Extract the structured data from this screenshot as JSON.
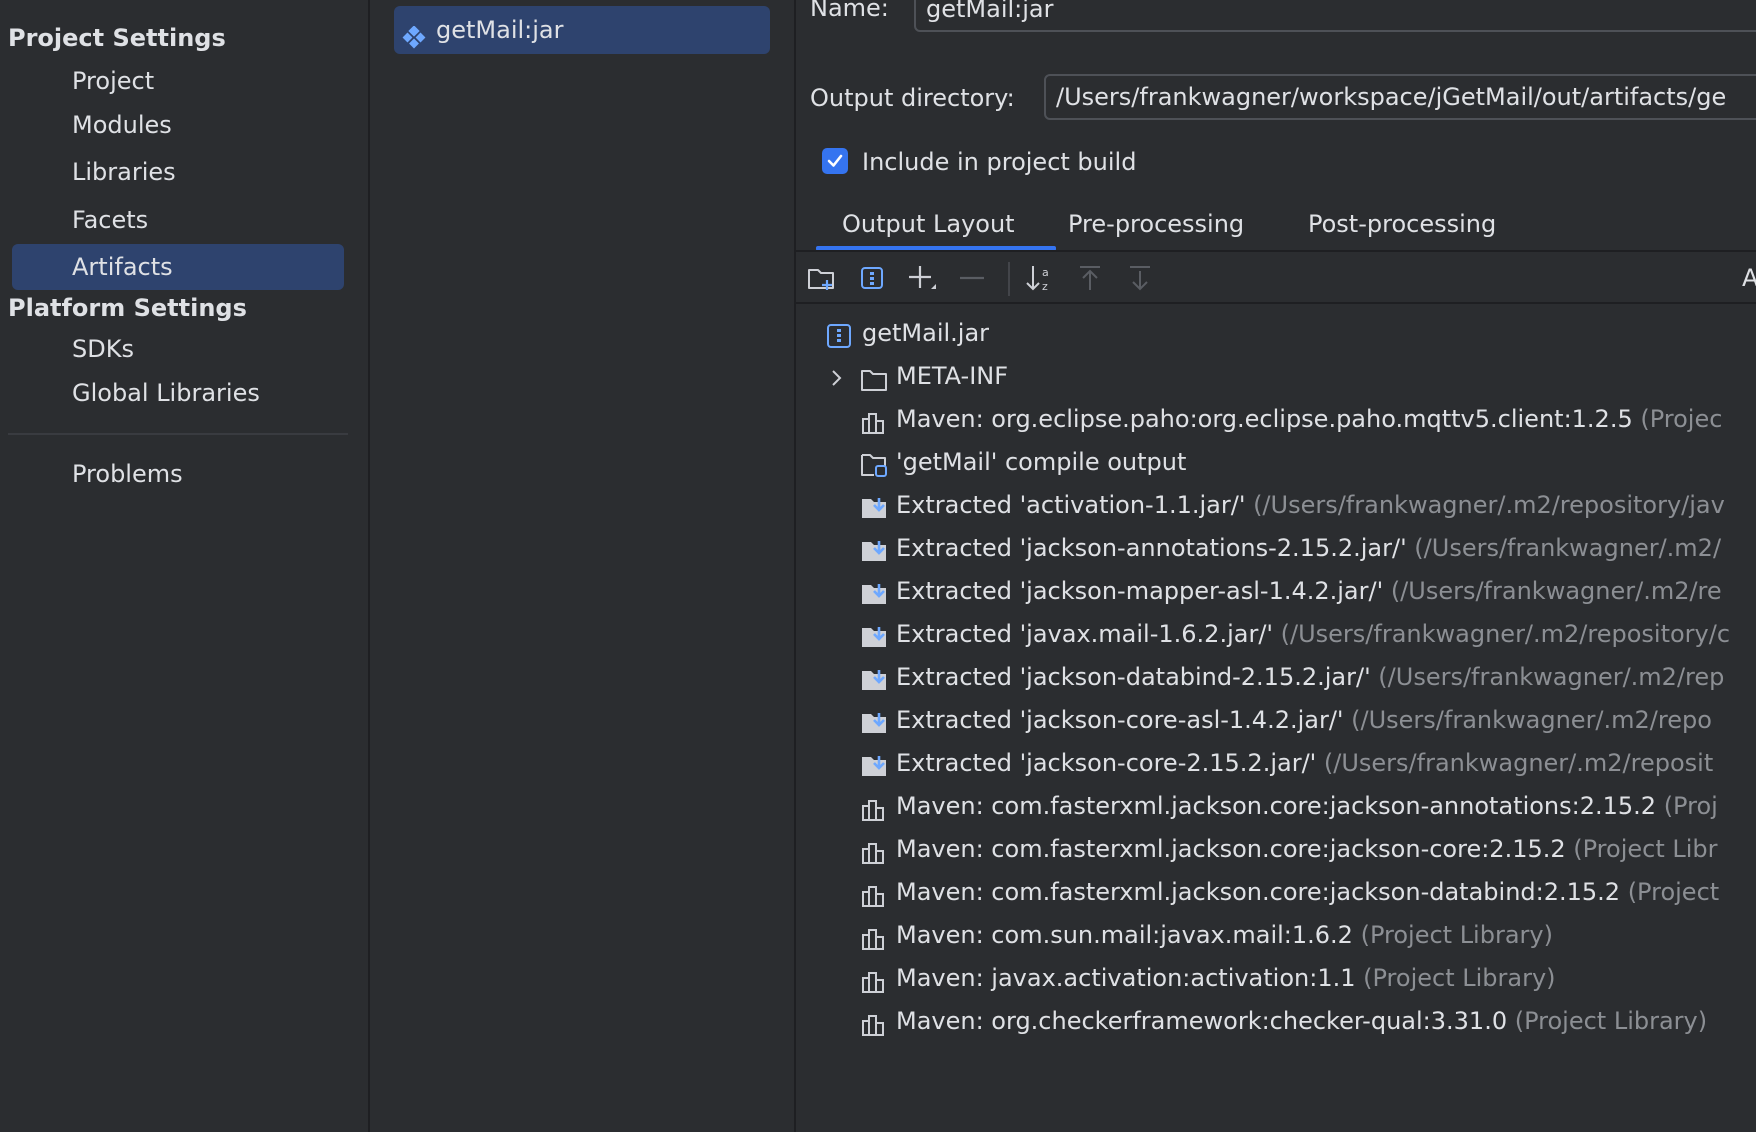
{
  "left_nav": {
    "project_settings_header": "Project Settings",
    "project_items": [
      "Project",
      "Modules",
      "Libraries",
      "Facets",
      "Artifacts"
    ],
    "selected_item": "Artifacts",
    "platform_settings_header": "Platform Settings",
    "platform_items": [
      "SDKs",
      "Global Libraries"
    ],
    "problems": "Problems"
  },
  "artifact_list": {
    "items": [
      {
        "label": "getMail:jar",
        "icon": "jar-artifact-icon"
      }
    ]
  },
  "details": {
    "name_label": "Name:",
    "name_value": "getMail:jar",
    "output_dir_label": "Output directory:",
    "output_dir_value": "/Users/frankwagner/workspace/jGetMail/out/artifacts/ge",
    "include_label": "Include in project build",
    "include_checked": true,
    "tabs": [
      "Output Layout",
      "Pre-processing",
      "Post-processing"
    ],
    "selected_tab": "Output Layout",
    "toolbar": {
      "icons": [
        "new-folder-icon",
        "archive-icon",
        "add-icon",
        "remove-icon",
        "sort-icon",
        "move-up-icon",
        "move-down-icon"
      ],
      "right_edge_text": "A"
    },
    "tree": {
      "root": {
        "icon": "archive-icon",
        "text": "getMail.jar"
      },
      "items": [
        {
          "icon": "folder-icon",
          "text": "META-INF",
          "hint": "",
          "expandable": true
        },
        {
          "icon": "library-icon",
          "text": "Maven: org.eclipse.paho:org.eclipse.paho.mqttv5.client:1.2.5",
          "hint": "(Projec"
        },
        {
          "icon": "module-output-icon",
          "text": "'getMail' compile output",
          "hint": ""
        },
        {
          "icon": "extracted-icon",
          "text": "Extracted 'activation-1.1.jar/'",
          "hint": "(/Users/frankwagner/.m2/repository/jav"
        },
        {
          "icon": "extracted-icon",
          "text": "Extracted 'jackson-annotations-2.15.2.jar/'",
          "hint": "(/Users/frankwagner/.m2/"
        },
        {
          "icon": "extracted-icon",
          "text": "Extracted 'jackson-mapper-asl-1.4.2.jar/'",
          "hint": "(/Users/frankwagner/.m2/re"
        },
        {
          "icon": "extracted-icon",
          "text": "Extracted 'javax.mail-1.6.2.jar/'",
          "hint": "(/Users/frankwagner/.m2/repository/c"
        },
        {
          "icon": "extracted-icon",
          "text": "Extracted 'jackson-databind-2.15.2.jar/'",
          "hint": "(/Users/frankwagner/.m2/rep"
        },
        {
          "icon": "extracted-icon",
          "text": "Extracted 'jackson-core-asl-1.4.2.jar/'",
          "hint": "(/Users/frankwagner/.m2/repo"
        },
        {
          "icon": "extracted-icon",
          "text": "Extracted 'jackson-core-2.15.2.jar/'",
          "hint": "(/Users/frankwagner/.m2/reposit"
        },
        {
          "icon": "library-icon",
          "text": "Maven: com.fasterxml.jackson.core:jackson-annotations:2.15.2",
          "hint": "(Proj"
        },
        {
          "icon": "library-icon",
          "text": "Maven: com.fasterxml.jackson.core:jackson-core:2.15.2",
          "hint": "(Project Libr"
        },
        {
          "icon": "library-icon",
          "text": "Maven: com.fasterxml.jackson.core:jackson-databind:2.15.2",
          "hint": "(Project"
        },
        {
          "icon": "library-icon",
          "text": "Maven: com.sun.mail:javax.mail:1.6.2",
          "hint": "(Project Library)"
        },
        {
          "icon": "library-icon",
          "text": "Maven: javax.activation:activation:1.1",
          "hint": "(Project Library)"
        },
        {
          "icon": "library-icon",
          "text": "Maven: org.checkerframework:checker-qual:3.31.0",
          "hint": "(Project Library)"
        }
      ]
    }
  },
  "colors": {
    "background": "#2b2d30",
    "selection": "#2e436e",
    "accent": "#3574f0",
    "text": "#dfe1e5",
    "hint_text": "#8c8f94"
  }
}
